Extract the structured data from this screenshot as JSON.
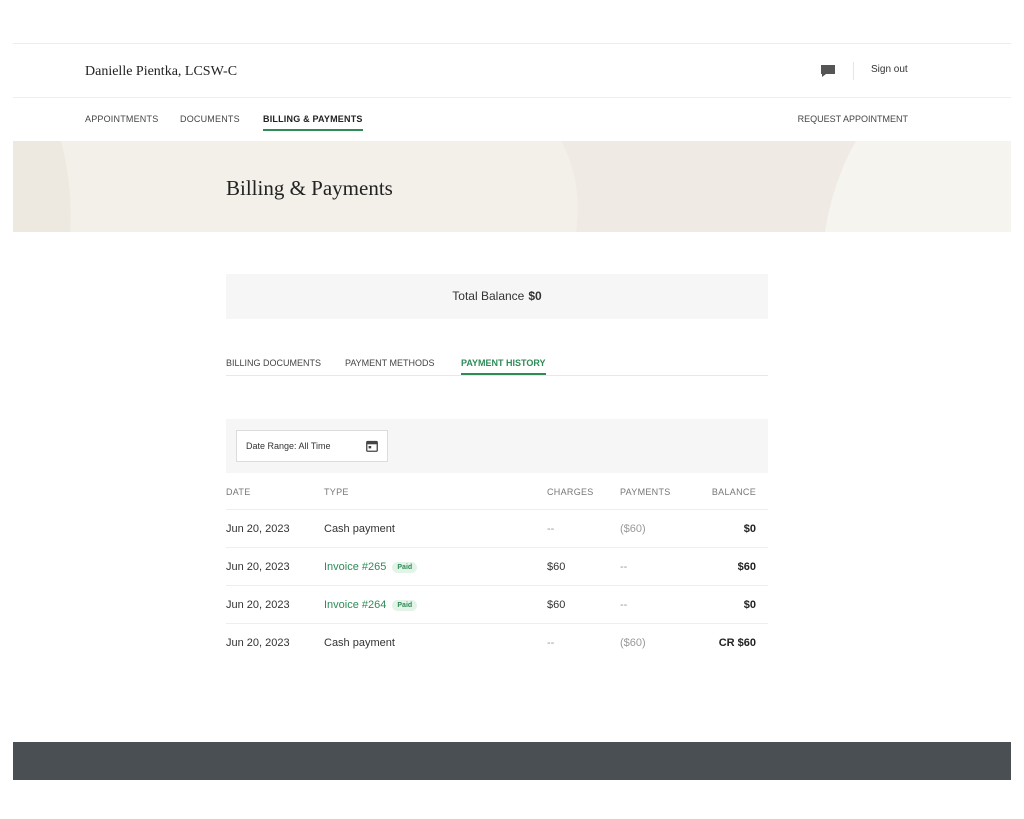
{
  "header": {
    "provider_name": "Danielle Pientka, LCSW-C",
    "chat_icon": "chat-bubble-icon",
    "sign_out": "Sign out"
  },
  "nav": {
    "items": [
      {
        "label": "APPOINTMENTS"
      },
      {
        "label": "DOCUMENTS"
      },
      {
        "label": "BILLING & PAYMENTS",
        "active": true
      }
    ],
    "request_appointment": "REQUEST APPOINTMENT"
  },
  "page": {
    "title": "Billing & Payments"
  },
  "balance": {
    "label": "Total Balance",
    "amount": "$0"
  },
  "tabs": [
    {
      "label": "BILLING DOCUMENTS"
    },
    {
      "label": "PAYMENT METHODS"
    },
    {
      "label": "PAYMENT HISTORY",
      "active": true
    }
  ],
  "filter": {
    "date_range": "Date Range: All Time",
    "icon": "calendar-icon"
  },
  "table": {
    "columns": [
      "DATE",
      "TYPE",
      "CHARGES",
      "PAYMENTS",
      "BALANCE"
    ],
    "rows": [
      {
        "date": "Jun 20, 2023",
        "type": "Cash payment",
        "charges": "--",
        "payments": "($60)",
        "balance": "$0"
      },
      {
        "date": "Jun 20, 2023",
        "type": "Invoice #265",
        "badge": "Paid",
        "charges": "$60",
        "payments": "--",
        "balance": "$60"
      },
      {
        "date": "Jun 20, 2023",
        "type": "Invoice #264",
        "badge": "Paid",
        "charges": "$60",
        "payments": "--",
        "balance": "$0"
      },
      {
        "date": "Jun 20, 2023",
        "type": "Cash payment",
        "charges": "--",
        "payments": "($60)",
        "balance": "CR $60"
      }
    ]
  },
  "colors": {
    "accent": "#2e8b57",
    "banner_bg": "#f3f0ea",
    "footer_bg": "#4a4f54"
  }
}
